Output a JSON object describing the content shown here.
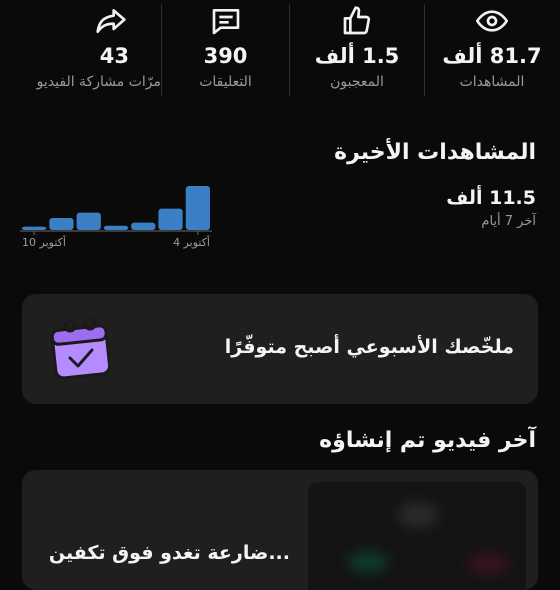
{
  "stats": [
    {
      "icon": "eye-icon",
      "value": "81.7 ألف",
      "label": "المشاهدات"
    },
    {
      "icon": "thumbs-up-icon",
      "value": "1.5 ألف",
      "label": "المعجبون"
    },
    {
      "icon": "comment-icon",
      "value": "390",
      "label": "التعليقات"
    },
    {
      "icon": "share-arrow-icon",
      "value": "43",
      "label": "مرّات مشاركة الفيديو"
    }
  ],
  "recent": {
    "title": "المشاهدات الأخيرة",
    "total": "11.5 ألف",
    "period": "آخر 7 أيام"
  },
  "chart_data": {
    "type": "bar",
    "categories": [
      "10 أكتوبر",
      "",
      "",
      "",
      "",
      "",
      "4 أكتوبر"
    ],
    "values": [
      2.5,
      9,
      13,
      3.2,
      5.5,
      16,
      33
    ],
    "xtick_labels": [
      "10 أكتوبر",
      "4 أكتوبر"
    ],
    "bar_color": "#3b7fc4",
    "grid": false
  },
  "summary": {
    "text": "ملخّصك الأسبوعي أصبح متوفّرًا",
    "icon": "calendar-check-icon",
    "icon_color": "#b58cff"
  },
  "latest": {
    "title": "آخر فيديو تم إنشاؤه",
    "video_title": "...ضارعة تغدو فوق تكفين"
  }
}
